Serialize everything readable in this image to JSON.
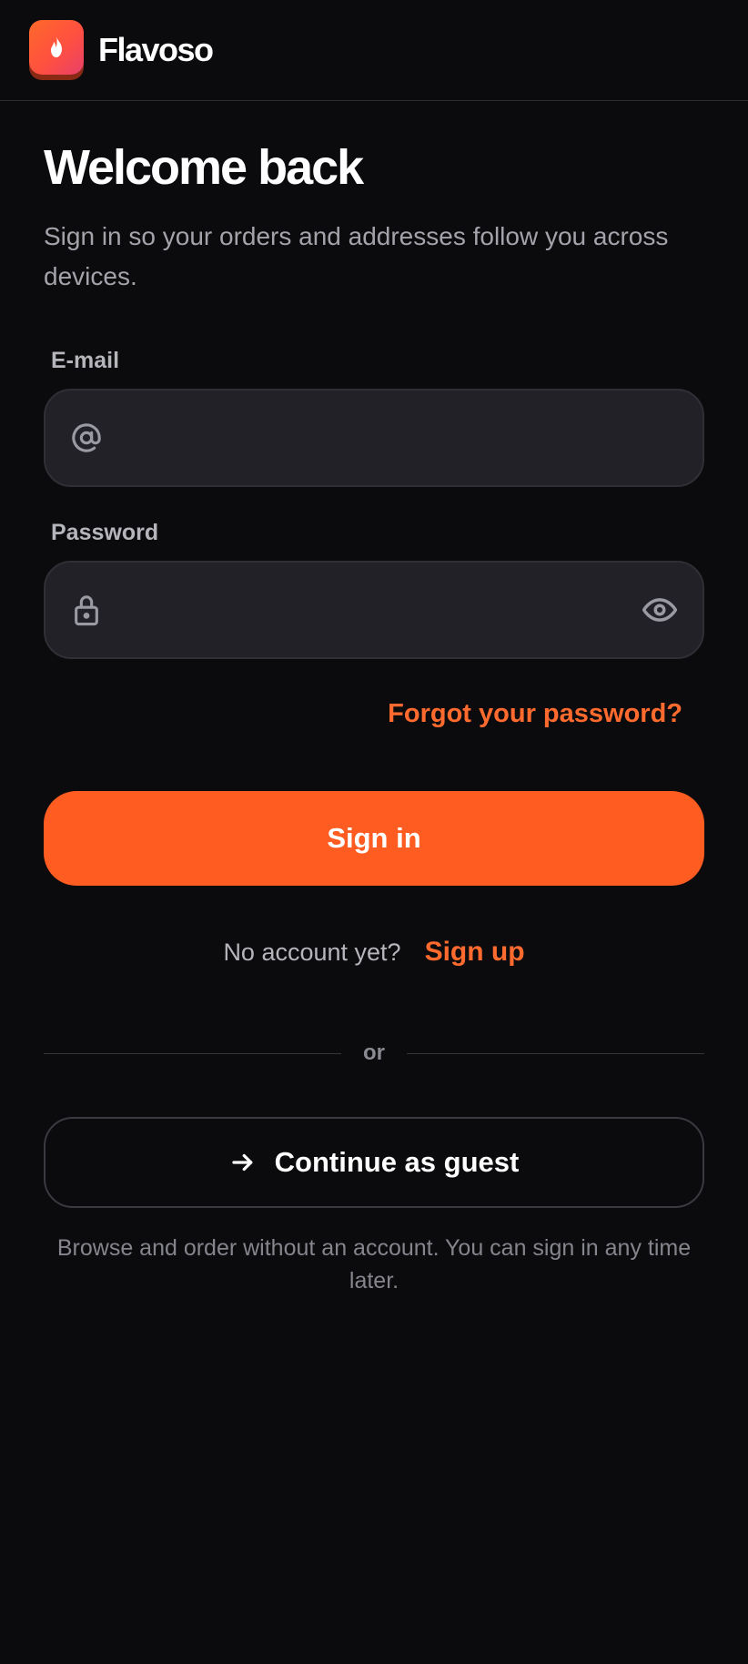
{
  "app": {
    "brand": "Flavoso",
    "logo_icon": "flame-icon",
    "accent_color": "#ff5c22"
  },
  "main": {
    "title": "Welcome back",
    "subtitle": "Sign in so your orders and addresses follow you across devices."
  },
  "form": {
    "email": {
      "label": "E-mail",
      "value": "",
      "placeholder": "",
      "icon": "at-sign-icon"
    },
    "password": {
      "label": "Password",
      "value": "",
      "placeholder": "",
      "icon": "lock-icon",
      "toggle_icon": "eye-icon"
    },
    "forgot_label": "Forgot your password?",
    "submit_label": "Sign in"
  },
  "signup": {
    "prompt": "No account yet?",
    "link_label": "Sign up"
  },
  "divider": {
    "label": "or"
  },
  "guest": {
    "button_label": "Continue as guest",
    "icon": "arrow-right-icon",
    "note": "Browse and order without an account. You can sign in any time later."
  }
}
